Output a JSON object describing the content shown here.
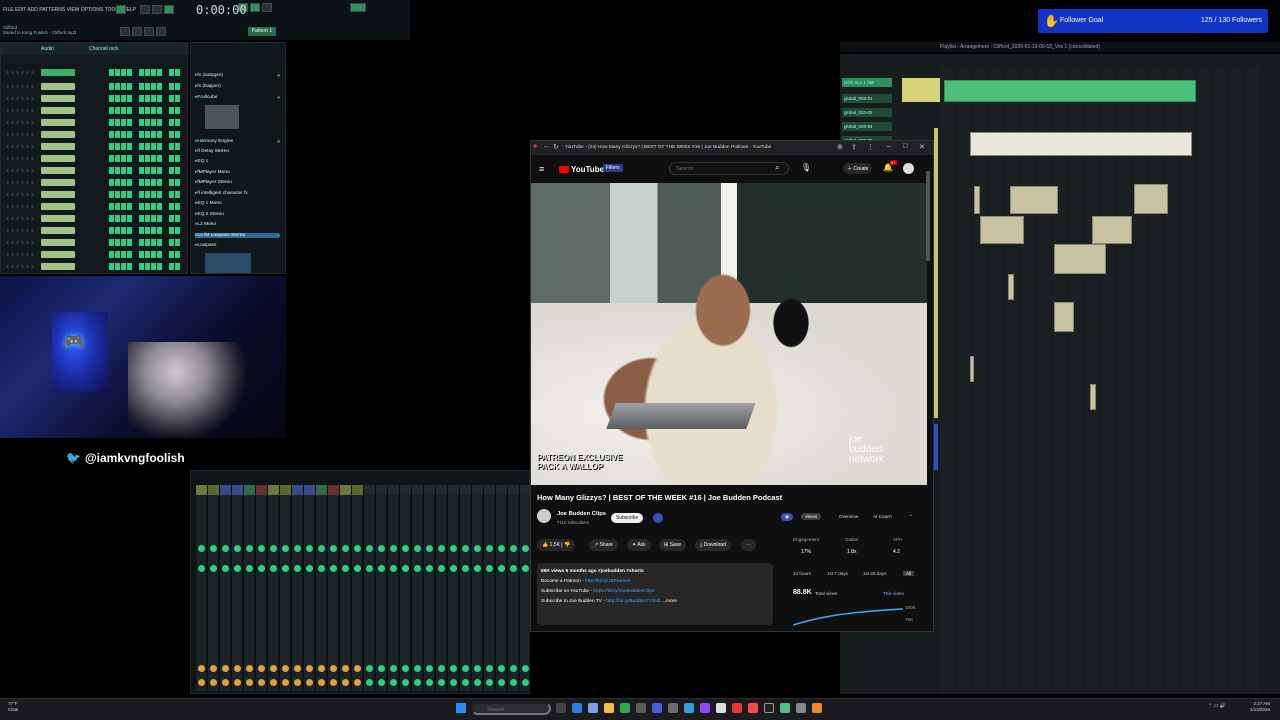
{
  "fl": {
    "menu": "FILE EDIT ADD PATTERNS VIEW OPTIONS TOOLS HELP",
    "hint_line1": "Clifford",
    "hint_line2": "Saved to Kvng Foolish - Clifford.mp3",
    "clock": "0:00:00",
    "pattern_label": "Pattern 1",
    "channel_rack_label": "Channel rack",
    "audio_label": "Audio",
    "browser_items": [
      "fx (autogen)",
      "fx (trapper)",
      "Fruitcube",
      "Harmony Engine",
      "fl Delay Stereo",
      "EQ 1",
      "fMPlayer Mono",
      "fMPlayer Stereo",
      "fl intelligent character fx",
      "EQ 1 Mono",
      "EQ 2 Stereo",
      "L2 Mono",
      "L2 fM Lowpass Stereo",
      "Lowpass"
    ],
    "playlist_title": "Playlist - Arrangement - Clifford_2026-01-13-00-53_Vox 1 (consolidated)",
    "playlist_tracks": [
      "CO7 ALL 1 AM",
      "global_003-01",
      "global_003-02",
      "global_003-04",
      "global_003-05"
    ]
  },
  "overlay": {
    "twitter_handle": "@iamkvngfoolish",
    "follower_goal_label": "Follower Goal",
    "follower_goal_count": "125 / 130 Followers"
  },
  "youtube": {
    "tab_title": "YouTube - (24) How Many Glizzys? | BEST OF THE WEEK #16 | Joe Budden Podcast - YouTube",
    "logo_text": "YouTube",
    "filters_label": "Filters",
    "search_placeholder": "Search",
    "create_label": "Create",
    "notification_count": "9+",
    "video_overlay_line1": "PATREON EXCLUSIVE",
    "video_overlay_line2": "PACK A WALLOP",
    "watermark_line1": "joe",
    "watermark_line2": "budden",
    "watermark_line3": "network",
    "video_title": "How Many Glizzys? | BEST OF THE WEEK #16 | Joe Budden Podcast",
    "channel_name": "Joe Budden Clips",
    "channel_subs": "711K subscribers",
    "subscribe_label": "Subscribe",
    "like_count": "1.5K",
    "share_label": "Share",
    "ask_label": "Ask",
    "save_label": "Save",
    "download_label": "Download",
    "description": {
      "meta": "89K views 6 months ago #joebudden #shorts",
      "line2_text": "Become a Patreon - ",
      "line2_link": "http://bit.ly/JBPatreon",
      "line3_text": "Subscribe on YouTube - ",
      "line3_link": "https://bit.ly/JoeBuddenClips",
      "line4_text": "Subscribe to Joe Budden TV - ",
      "line4_link": "http://bit.ly/BuddenTVSub",
      "more": "...more"
    },
    "stats": {
      "tab_views": "Views",
      "tab_overview": "Overview",
      "tab_ai": "AI Coach",
      "engagement_label": "Engagement",
      "engagement_value": "17%",
      "outlier_label": "Outlier",
      "outlier_value": "1.8x",
      "vph_label": "VPH",
      "vph_value": "4.2",
      "range_24h": "24 hours",
      "range_7d": "1st 7 days",
      "range_28d": "1st 28 days",
      "range_all": "All",
      "total_views_value": "88.8K",
      "total_views_label": "Total views",
      "this_video_label": "This video",
      "y_top": "100K",
      "y_mid": "75K"
    }
  },
  "taskbar": {
    "weather_temp": "77°F",
    "weather_desc": "Clear",
    "search_placeholder": "Search",
    "time": "2:27 AM",
    "date": "1/13/2026"
  }
}
